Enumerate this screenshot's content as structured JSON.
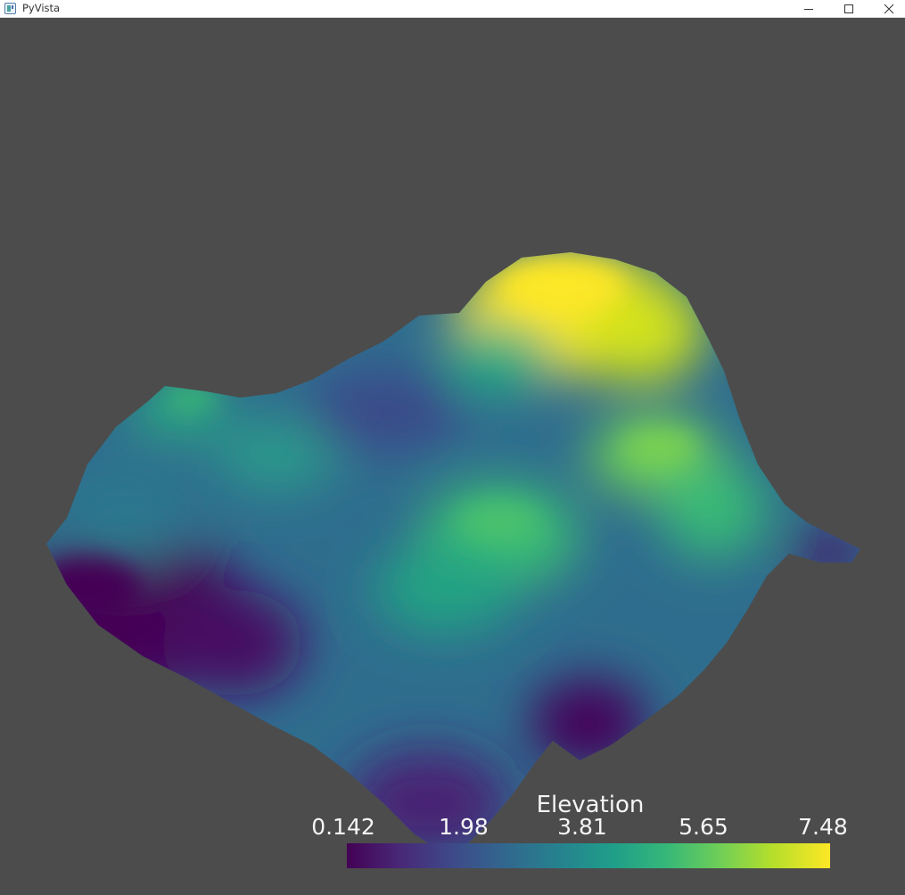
{
  "window": {
    "title": "PyVista"
  },
  "controls": {
    "minimize": "minimize",
    "maximize": "maximize",
    "close": "close"
  },
  "scalar_bar": {
    "title": "Elevation",
    "ticks": [
      "0.142",
      "1.98",
      "3.81",
      "5.65",
      "7.48"
    ],
    "range": [
      0.142,
      7.48
    ],
    "colormap": "viridis",
    "colors": [
      "#440154",
      "#482878",
      "#3e4a89",
      "#31688e",
      "#26828e",
      "#1f9e89",
      "#35b779",
      "#6ece58",
      "#b5de2b",
      "#fde725"
    ]
  },
  "scene": {
    "background": "#4c4c4c",
    "object": "surface-mesh"
  }
}
